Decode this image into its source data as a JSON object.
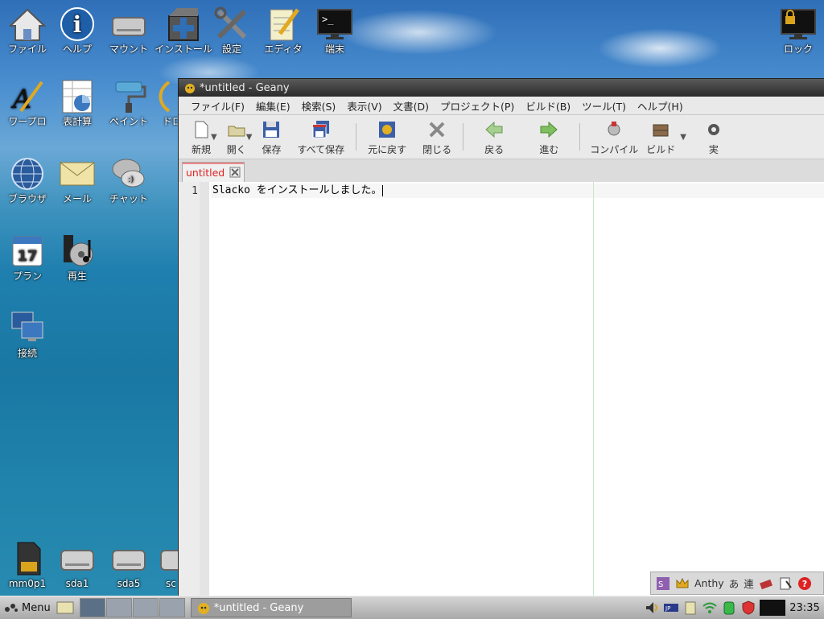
{
  "desktop": {
    "icons": [
      {
        "label": "ファイル",
        "icon": "home-icon"
      },
      {
        "label": "ヘルプ",
        "icon": "info-icon"
      },
      {
        "label": "マウント",
        "icon": "drive-icon"
      },
      {
        "label": "インストール",
        "icon": "install-box-icon"
      },
      {
        "label": "設定",
        "icon": "tools-icon"
      },
      {
        "label": "エディタ",
        "icon": "notepad-icon"
      },
      {
        "label": "端末",
        "icon": "terminal-icon"
      },
      {
        "label": "ロック",
        "icon": "lock-screen-icon"
      },
      {
        "label": "ワープロ",
        "icon": "word-processor-icon"
      },
      {
        "label": "表計算",
        "icon": "spreadsheet-icon"
      },
      {
        "label": "ペイント",
        "icon": "paint-roller-icon"
      },
      {
        "label": "ドロ",
        "icon": "draw-icon"
      },
      {
        "label": "ブラウザ",
        "icon": "globe-icon"
      },
      {
        "label": "メール",
        "icon": "envelope-icon"
      },
      {
        "label": "チャット",
        "icon": "chat-icon"
      },
      {
        "label": "プラン",
        "icon": "calendar-icon"
      },
      {
        "label": "再生",
        "icon": "media-player-icon"
      },
      {
        "label": "接続",
        "icon": "network-connect-icon"
      },
      {
        "label": "mm0p1",
        "icon": "sd-card-icon"
      },
      {
        "label": "sda1",
        "icon": "hdd-icon"
      },
      {
        "label": "sda5",
        "icon": "hdd-icon"
      },
      {
        "label": "sc",
        "icon": "hdd-icon"
      }
    ],
    "calendar_day": "17"
  },
  "window": {
    "title": "*untitled - Geany",
    "menu": [
      "ファイル(F)",
      "編集(E)",
      "検索(S)",
      "表示(V)",
      "文書(D)",
      "プロジェクト(P)",
      "ビルド(B)",
      "ツール(T)",
      "ヘルプ(H)"
    ],
    "toolbar": {
      "new": "新規",
      "open": "開く",
      "save": "保存",
      "save_all": "すべて保存",
      "revert": "元に戻す",
      "close": "閉じる",
      "back": "戻る",
      "forward": "進む",
      "compile": "コンパイル",
      "build": "ビルド",
      "run": "実"
    },
    "tab": {
      "label": "untitled"
    },
    "editor": {
      "line_number": "1",
      "text": "Slacko をインストールしました。"
    }
  },
  "tray_popup": {
    "ime_name": "Anthy",
    "hiragana": "あ",
    "mode": "連"
  },
  "taskbar": {
    "menu_label": "Menu",
    "task_title": "*untitled - Geany",
    "clock": "23:35"
  },
  "colors": {
    "tab_text": "#dd2222",
    "long_line_marker": "#c8e6c8"
  }
}
